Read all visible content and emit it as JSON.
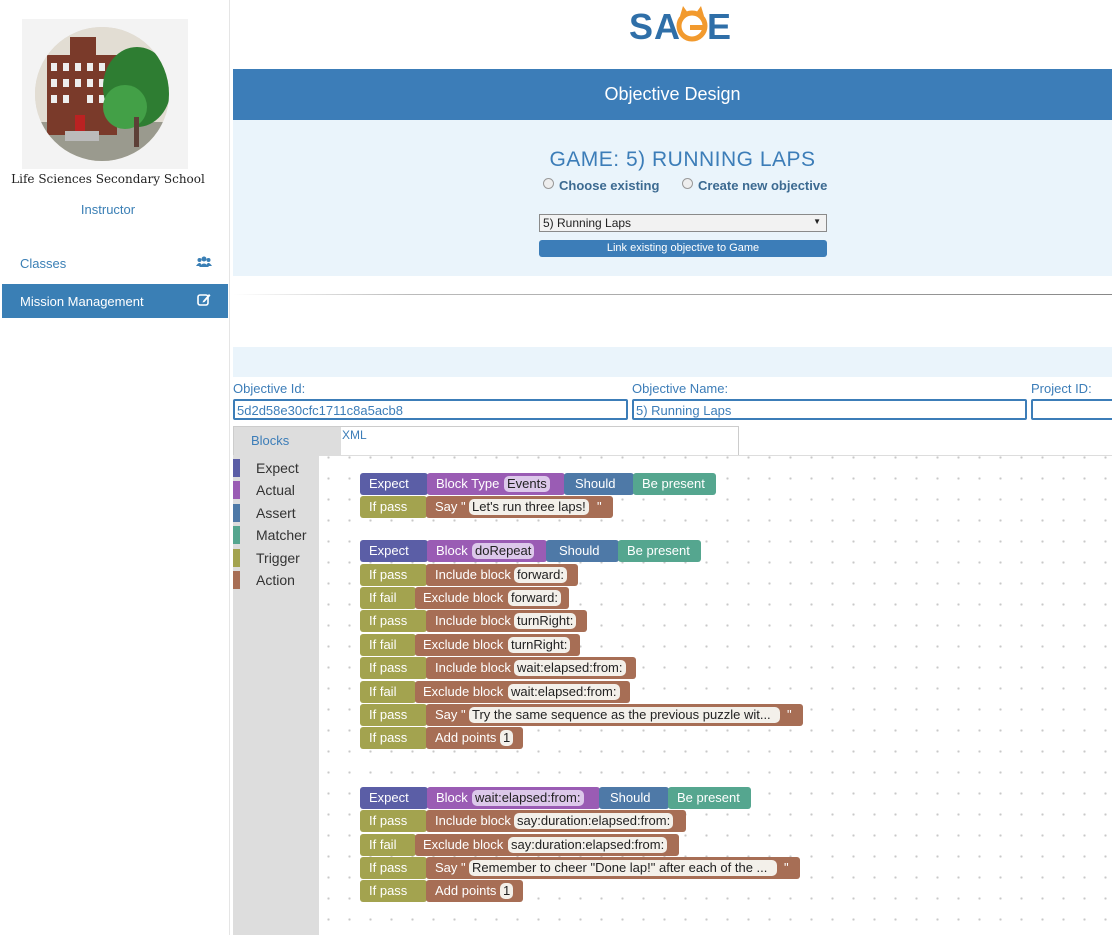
{
  "sidebar": {
    "school_name": "Life Sciences Secondary School",
    "role": "Instructor",
    "items": [
      {
        "label": "Classes",
        "icon": "users-icon"
      },
      {
        "label": "Mission Management",
        "icon": "edit-icon"
      }
    ]
  },
  "header": {
    "logo": "SAGE",
    "banner": "Objective Design"
  },
  "game": {
    "title": "GAME: 5) RUNNING LAPS",
    "option_choose": "Choose existing",
    "option_create": "Create new objective",
    "select_value": "5) Running Laps",
    "link_button": "Link existing objective to Game"
  },
  "form": {
    "objective_id_label": "Objective Id:",
    "objective_id_value": "5d2d58e30cfc1711c8a5acb8",
    "objective_name_label": "Objective Name:",
    "objective_name_value": "5) Running Laps",
    "project_id_label": "Project ID:",
    "project_id_value": ""
  },
  "tabs": {
    "blocks": "Blocks",
    "xml": "XML"
  },
  "toolbox": [
    {
      "label": "Expect",
      "color": "#5b5ea6"
    },
    {
      "label": "Actual",
      "color": "#9a5cb4"
    },
    {
      "label": "Assert",
      "color": "#4e79a7"
    },
    {
      "label": "Matcher",
      "color": "#55a68f"
    },
    {
      "label": "Trigger",
      "color": "#a3a34f"
    },
    {
      "label": "Action",
      "color": "#a76e55"
    }
  ],
  "blocks": {
    "expect": "Expect",
    "should": "Should",
    "be_present": "Be present",
    "if_pass": "If pass",
    "if_fail": "If fail",
    "block_type": "Block Type",
    "block": "Block",
    "say": "Say \"",
    "quote": "\"",
    "include_block": "Include block",
    "exclude_block": "Exclude block",
    "add_points": "Add points",
    "g1": {
      "type_value": "Events",
      "say_text": "Let's run three laps!"
    },
    "g2": {
      "block_value": "doRepeat",
      "inc1": "forward:",
      "exc1": "forward:",
      "inc2": "turnRight:",
      "exc2": "turnRight:",
      "inc3": "wait:elapsed:from:",
      "exc3": "wait:elapsed:from:",
      "say_text": "Try the same sequence as the previous puzzle wit...",
      "points": "1"
    },
    "g3": {
      "block_value": "wait:elapsed:from:",
      "inc1": "say:duration:elapsed:from:",
      "exc1": "say:duration:elapsed:from:",
      "say_text": "Remember to cheer \"Done lap!\" after each of the ...",
      "points": "1"
    }
  }
}
